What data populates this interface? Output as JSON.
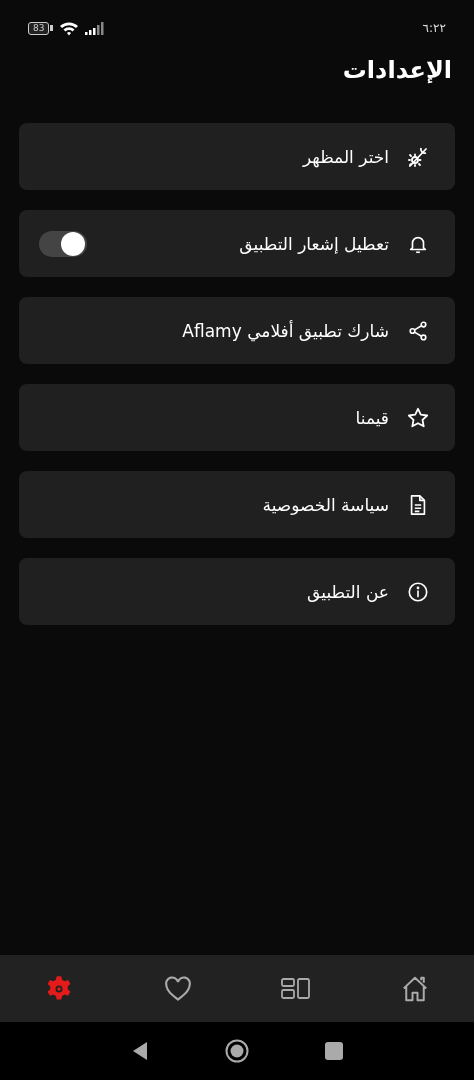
{
  "status_bar": {
    "battery": "83",
    "time": "٦:٢٢"
  },
  "title": "الإعدادات",
  "settings": [
    {
      "kind": "link",
      "label": "اختر المظهر"
    },
    {
      "kind": "toggle",
      "label": "تعطيل إشعار التطبيق",
      "on": true
    },
    {
      "kind": "link",
      "label": "شارك تطبيق أفلامي Aflamy"
    },
    {
      "kind": "link",
      "label": "قيمنا"
    },
    {
      "kind": "link",
      "label": "سياسة الخصوصية"
    },
    {
      "kind": "link",
      "label": "عن التطبيق"
    }
  ],
  "bottom_nav": [
    {
      "selected": false
    },
    {
      "selected": false
    },
    {
      "selected": false
    },
    {
      "selected": true
    }
  ]
}
